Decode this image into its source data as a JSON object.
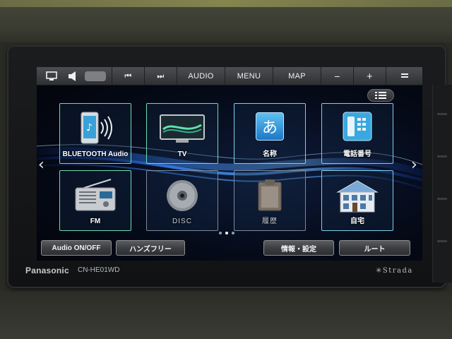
{
  "device": {
    "brand": "Panasonic",
    "model": "CN-HE01WD",
    "series": "✳Strada"
  },
  "topbar": {
    "prev_label": "⏮",
    "next_label": "⏭",
    "audio_label": "AUDIO",
    "menu_label": "MENU",
    "map_label": "MAP",
    "minus_label": "−",
    "plus_label": "+",
    "menu_icon": "hamburger-icon",
    "monitor_icon": "monitor-icon",
    "volume_icon": "speaker-icon"
  },
  "tiles": [
    {
      "label": "BLUETOOTH Audio",
      "icon": "bluetooth-audio-icon"
    },
    {
      "label": "TV",
      "icon": "tv-icon"
    },
    {
      "label": "名称",
      "icon": "name-search-icon"
    },
    {
      "label": "電話番号",
      "icon": "phone-number-icon"
    },
    {
      "label": "FM",
      "icon": "radio-icon"
    },
    {
      "label": "DISC",
      "icon": "disc-icon"
    },
    {
      "label": "履歴",
      "icon": "history-icon"
    },
    {
      "label": "自宅",
      "icon": "home-icon"
    }
  ],
  "name_icon_char": "あ",
  "bottom": {
    "audio_onoff": "Audio ON/OFF",
    "handsfree": "ハンズフリー",
    "info_settings": "情報・設定",
    "route": "ルート"
  },
  "nav": {
    "left_arrow": "‹",
    "right_arrow": "›"
  },
  "pager": {
    "pages": 3,
    "current": 2
  },
  "colors": {
    "accent": "#7fd0ea",
    "screen_bg": "#050a18",
    "wave": "#2f7fff"
  }
}
